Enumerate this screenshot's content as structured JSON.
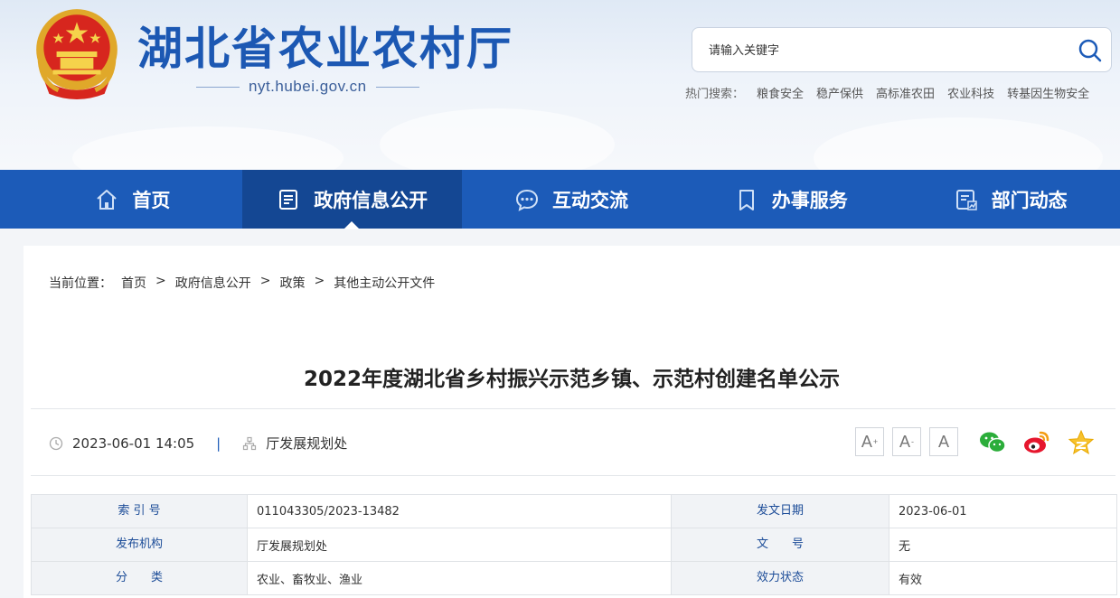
{
  "header": {
    "site_title": "湖北省农业农村厅",
    "domain": "nyt.hubei.gov.cn",
    "search_placeholder": "请输入关键字",
    "hot_label": "热门搜索：",
    "hot_items": [
      "粮食安全",
      "稳产保供",
      "高标准农田",
      "农业科技",
      "转基因生物安全"
    ]
  },
  "nav": {
    "items": [
      {
        "label": "首页",
        "icon": "home-icon"
      },
      {
        "label": "政府信息公开",
        "icon": "document-list-icon",
        "active": true
      },
      {
        "label": "互动交流",
        "icon": "chat-bubble-icon"
      },
      {
        "label": "办事服务",
        "icon": "bookmark-icon"
      },
      {
        "label": "部门动态",
        "icon": "news-chart-icon"
      }
    ]
  },
  "breadcrumb": {
    "label": "当前位置：",
    "items": [
      "首页",
      "政府信息公开",
      "政策",
      "其他主动公开文件"
    ],
    "separator": ">"
  },
  "article": {
    "title": "2022年度湖北省乡村振兴示范乡镇、示范村创建名单公示",
    "datetime": "2023-06-01 14:05",
    "divider": "|",
    "source": "厅发展规划处"
  },
  "font_controls": {
    "increase": "A",
    "increase_mark": "+",
    "decrease": "A",
    "decrease_mark": "-",
    "reset": "A"
  },
  "share": [
    "wechat-icon",
    "weibo-icon",
    "favorite-star-icon"
  ],
  "info_table": {
    "rows": [
      {
        "k1": "索 引 号",
        "v1": "011043305/2023-13482",
        "k2": "发文日期",
        "v2": "2023-06-01"
      },
      {
        "k1": "发布机构",
        "v1": "厅发展规划处",
        "k2": "文　　号",
        "v2": "无"
      },
      {
        "k1": "分　　类",
        "v1": "农业、畜牧业、渔业",
        "k2": "效力状态",
        "v2": "有效"
      }
    ]
  },
  "colors": {
    "brand_blue": "#1c5bb8",
    "nav_active": "#144793",
    "title_blue": "#1c58b3"
  }
}
